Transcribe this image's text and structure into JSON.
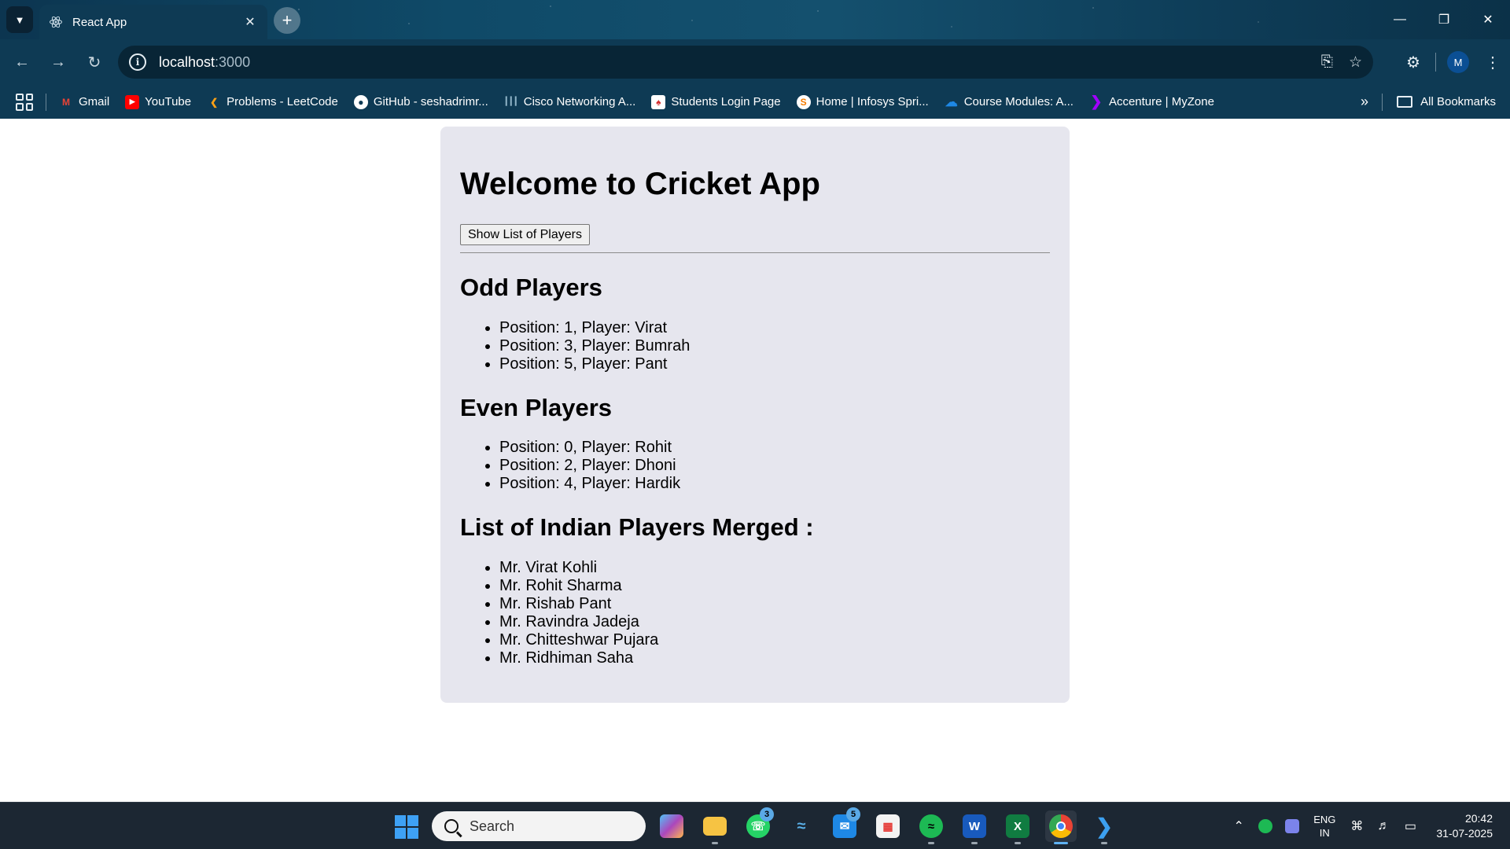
{
  "browser": {
    "tab_title": "React App",
    "url_host": "localhost",
    "url_port": ":3000",
    "profile_initial": "M",
    "bookmarks": [
      {
        "label": "Gmail",
        "icon": "gmail-icon",
        "color": "#ea4335"
      },
      {
        "label": "YouTube",
        "icon": "youtube-icon",
        "color": "#ff0000"
      },
      {
        "label": "Problems - LeetCode",
        "icon": "leetcode-icon",
        "color": "#ffa116"
      },
      {
        "label": "GitHub - seshadrimr...",
        "icon": "github-icon",
        "color": "#ffffff"
      },
      {
        "label": "Cisco Networking A...",
        "icon": "cisco-icon",
        "color": "#049fd9"
      },
      {
        "label": "Students Login Page",
        "icon": "students-icon",
        "color": "#d32f2f"
      },
      {
        "label": "Home | Infosys Spri...",
        "icon": "infosys-icon",
        "color": "#f57c00"
      },
      {
        "label": "Course Modules: A...",
        "icon": "course-icon",
        "color": "#1e88e5"
      },
      {
        "label": "Accenture | MyZone",
        "icon": "accenture-icon",
        "color": "#a100ff"
      }
    ],
    "all_bookmarks_label": "All Bookmarks"
  },
  "app": {
    "heading": "Welcome to Cricket App",
    "button_label": "Show List of Players",
    "odd_heading": "Odd Players",
    "odd_players": [
      "Position: 1, Player: Virat",
      "Position: 3, Player: Bumrah",
      "Position: 5, Player: Pant"
    ],
    "even_heading": "Even Players",
    "even_players": [
      "Position: 0, Player: Rohit",
      "Position: 2, Player: Dhoni",
      "Position: 4, Player: Hardik"
    ],
    "merged_heading": "List of Indian Players Merged :",
    "merged_players": [
      "Mr. Virat Kohli",
      "Mr. Rohit Sharma",
      "Mr. Rishab Pant",
      "Mr. Ravindra Jadeja",
      "Mr. Chitteshwar Pujara",
      "Mr. Ridhiman Saha"
    ]
  },
  "taskbar": {
    "search_placeholder": "Search",
    "whatsapp_badge": "3",
    "outlook_badge": "5",
    "lang_line1": "ENG",
    "lang_line2": "IN",
    "time": "20:42",
    "date": "31-07-2025"
  },
  "colors": {
    "card_background": "#e6e6ee",
    "chrome_frame": "#0e3a54",
    "taskbar": "#1c2733"
  }
}
